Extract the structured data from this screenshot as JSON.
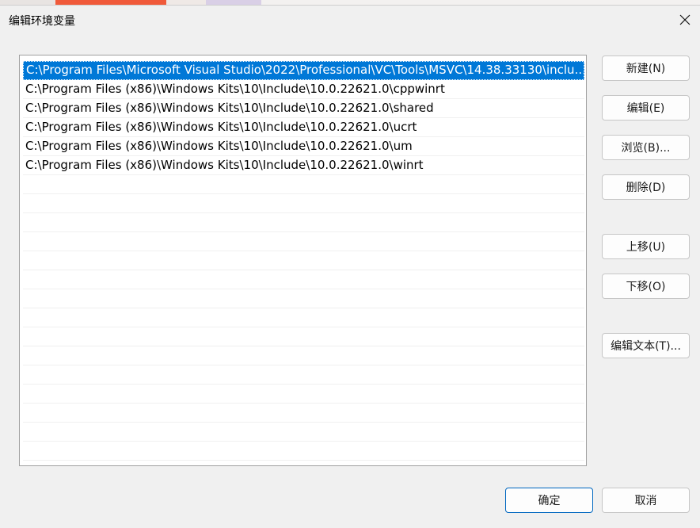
{
  "window": {
    "title": "编辑环境变量"
  },
  "list": {
    "items": [
      "C:\\Program Files\\Microsoft Visual Studio\\2022\\Professional\\VC\\Tools\\MSVC\\14.38.33130\\inclu...",
      "C:\\Program Files (x86)\\Windows Kits\\10\\Include\\10.0.22621.0\\cppwinrt",
      "C:\\Program Files (x86)\\Windows Kits\\10\\Include\\10.0.22621.0\\shared",
      "C:\\Program Files (x86)\\Windows Kits\\10\\Include\\10.0.22621.0\\ucrt",
      "C:\\Program Files (x86)\\Windows Kits\\10\\Include\\10.0.22621.0\\um",
      "C:\\Program Files (x86)\\Windows Kits\\10\\Include\\10.0.22621.0\\winrt"
    ],
    "selected_index": 0,
    "empty_rows": 15
  },
  "buttons": {
    "new": "新建(N)",
    "edit": "编辑(E)",
    "browse": "浏览(B)...",
    "delete": "删除(D)",
    "move_up": "上移(U)",
    "move_down": "下移(O)",
    "edit_text": "编辑文本(T)...",
    "ok": "确定",
    "cancel": "取消"
  },
  "colors": {
    "selection": "#0078d7",
    "accent_border": "#0067c0"
  }
}
